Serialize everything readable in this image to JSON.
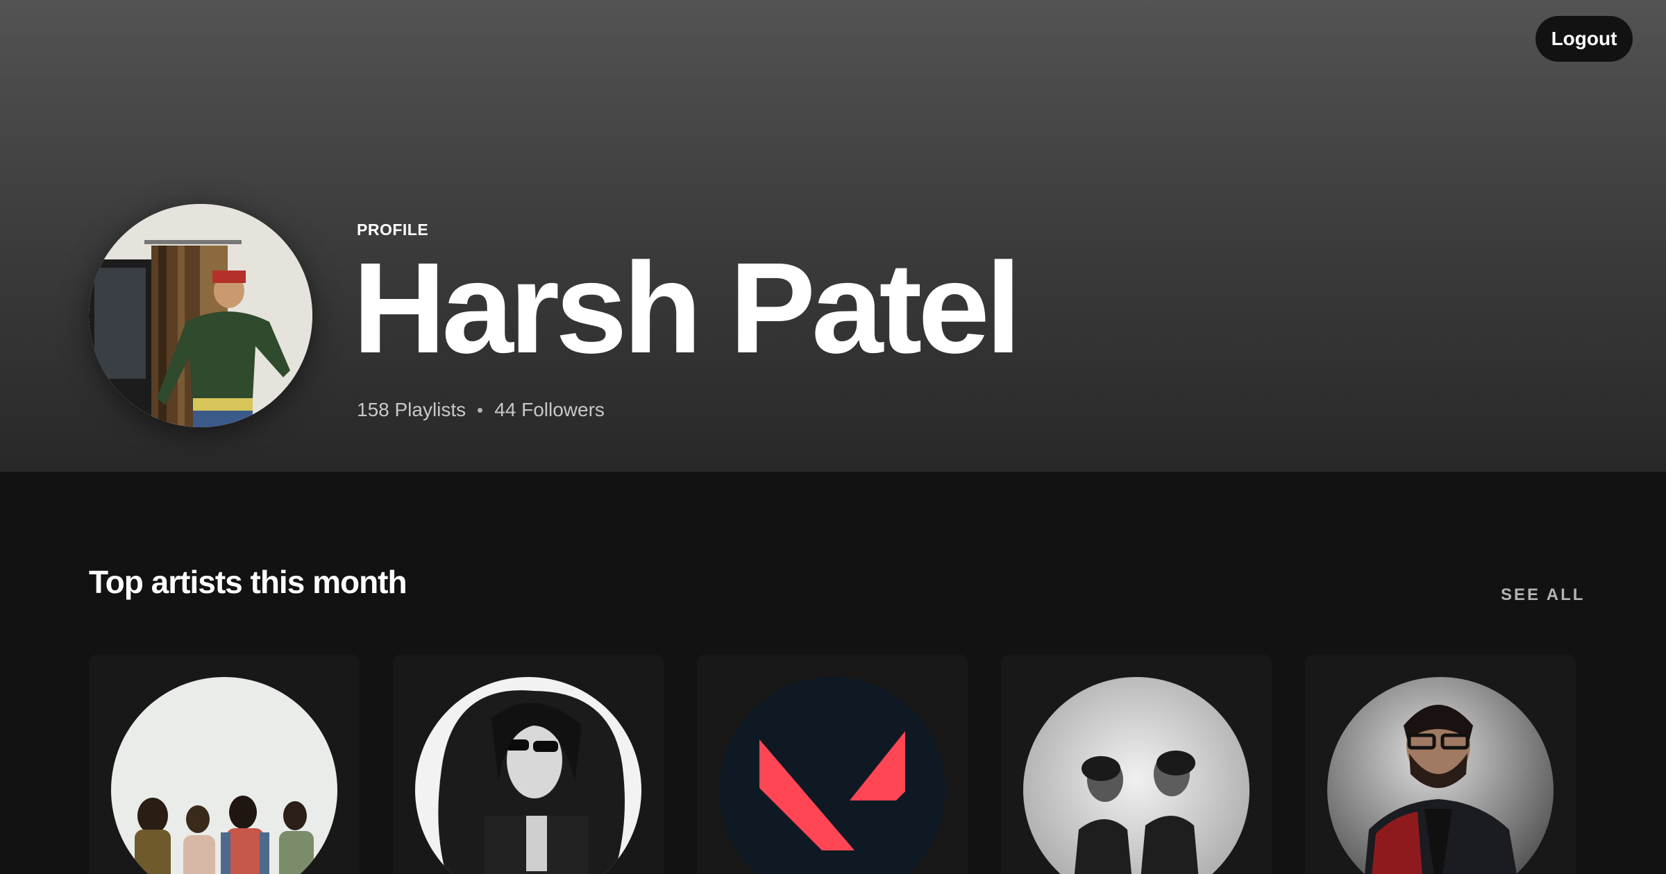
{
  "header": {
    "logout_label": "Logout"
  },
  "profile": {
    "label": "PROFILE",
    "name": "Harsh Patel",
    "playlists": "158 Playlists",
    "followers": "44 Followers"
  },
  "top_artists": {
    "title": "Top artists this month",
    "see_all_label": "SEE ALL",
    "artists": [
      {
        "image": "band-photo"
      },
      {
        "image": "long-hair-portrait"
      },
      {
        "image": "valorant-logo"
      },
      {
        "image": "duo-blurred-portrait"
      },
      {
        "image": "bearded-man-portrait"
      }
    ]
  },
  "colors": {
    "background": "#121212",
    "card": "#181818",
    "valorant_red": "#ff4655",
    "valorant_navy": "#0f1923"
  }
}
